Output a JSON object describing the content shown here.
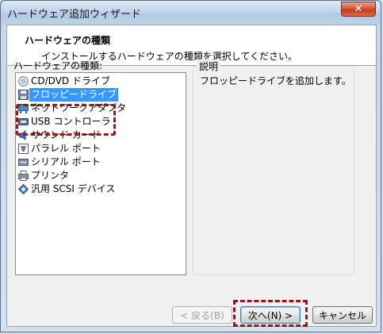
{
  "window": {
    "title": "ハードウェア追加ウィザード",
    "close_symbol": "✕"
  },
  "header": {
    "title": "ハードウェアの種類",
    "subtitle": "インストールするハードウェアの種類を選択してください。"
  },
  "list": {
    "label": "ハードウェアの種類:",
    "items": [
      {
        "label": "CD/DVD ドライブ",
        "icon": "cd-dvd-icon",
        "selected": false
      },
      {
        "label": "フロッピードライブ",
        "icon": "floppy-icon",
        "selected": true
      },
      {
        "label": "ネットワークアダプタ",
        "icon": "network-adapter-icon",
        "selected": false
      },
      {
        "label": "USB コントローラ",
        "icon": "usb-icon",
        "selected": false
      },
      {
        "label": "サウンド カード",
        "icon": "sound-icon",
        "selected": false
      },
      {
        "label": "パラレル ポート",
        "icon": "parallel-port-icon",
        "selected": false
      },
      {
        "label": "シリアル ポート",
        "icon": "serial-port-icon",
        "selected": false
      },
      {
        "label": "プリンタ",
        "icon": "printer-icon",
        "selected": false
      },
      {
        "label": "汎用 SCSI デバイス",
        "icon": "scsi-icon",
        "selected": false
      }
    ]
  },
  "description": {
    "title": "説明",
    "text": "フロッピードライブを追加します。"
  },
  "buttons": {
    "back": "< 戻る(B)",
    "next": "次へ(N) >",
    "cancel": "キャンセル"
  },
  "colors": {
    "selection": "#3399ff",
    "highlight_annotation": "#8b1c1c",
    "close_button": "#c94a2f"
  }
}
